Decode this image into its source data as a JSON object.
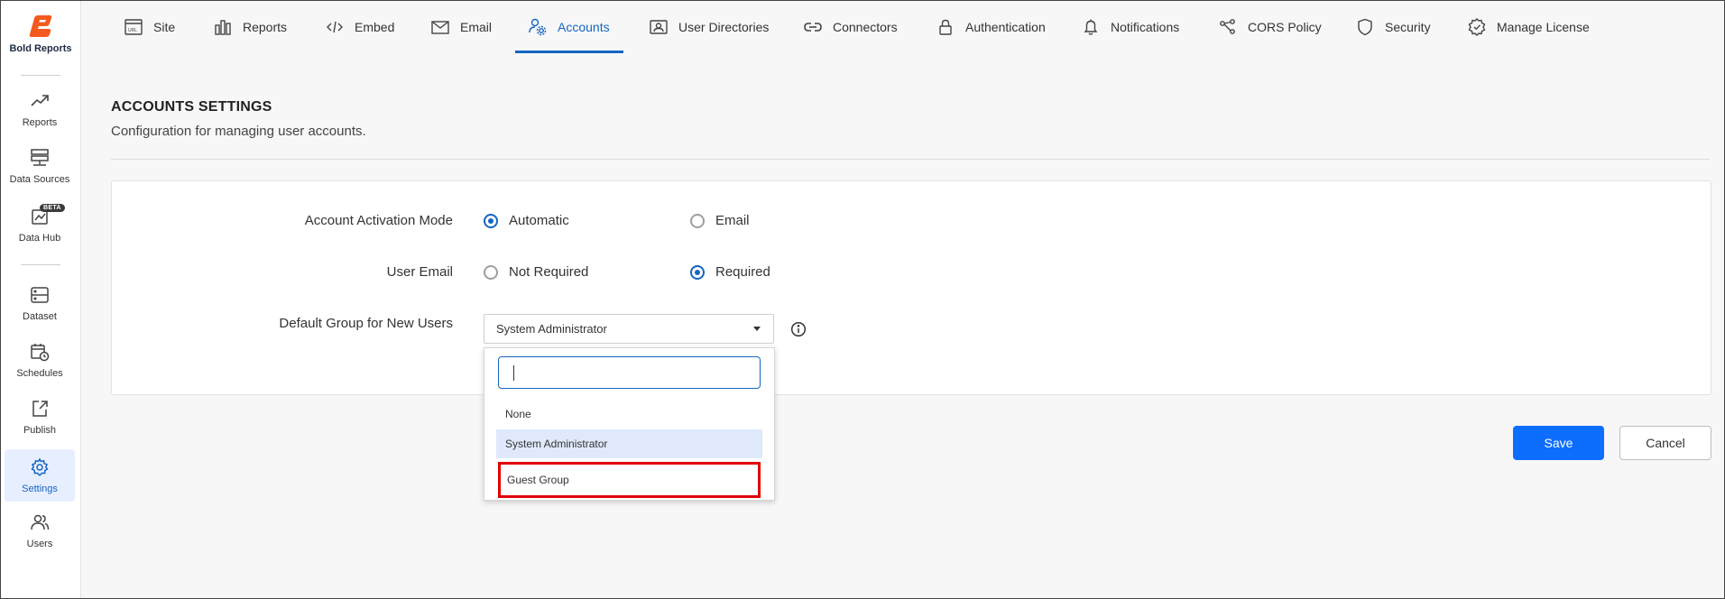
{
  "app": {
    "logo_text": "Bold Reports",
    "brand_color": "#f45a1f",
    "accent_color": "#1565c0"
  },
  "sidebar": {
    "items": [
      {
        "label": "Reports",
        "icon": "trending-up-icon"
      },
      {
        "label": "Data Sources",
        "icon": "server-icon"
      },
      {
        "label": "Data Hub",
        "icon": "data-hub-icon",
        "badge": "BETA"
      },
      {
        "label": "Dataset",
        "icon": "dataset-icon"
      },
      {
        "label": "Schedules",
        "icon": "calendar-clock-icon"
      },
      {
        "label": "Publish",
        "icon": "publish-icon"
      },
      {
        "label": "Settings",
        "icon": "gear-icon",
        "active": true
      },
      {
        "label": "Users",
        "icon": "users-icon"
      }
    ]
  },
  "tabs": [
    {
      "label": "Site",
      "icon": "url-icon"
    },
    {
      "label": "Reports",
      "icon": "bar-chart-icon"
    },
    {
      "label": "Embed",
      "icon": "code-icon"
    },
    {
      "label": "Email",
      "icon": "mail-icon"
    },
    {
      "label": "Accounts",
      "icon": "account-settings-icon",
      "active": true
    },
    {
      "label": "User Directories",
      "icon": "contact-card-icon"
    },
    {
      "label": "Connectors",
      "icon": "link-icon"
    },
    {
      "label": "Authentication",
      "icon": "lock-icon"
    },
    {
      "label": "Notifications",
      "icon": "bell-icon"
    },
    {
      "label": "CORS Policy",
      "icon": "share-nodes-icon"
    },
    {
      "label": "Security",
      "icon": "shield-icon"
    },
    {
      "label": "Manage License",
      "icon": "license-badge-icon"
    }
  ],
  "page": {
    "title": "ACCOUNTS SETTINGS",
    "subtitle": "Configuration for managing user accounts."
  },
  "settings": {
    "activation": {
      "label": "Account Activation Mode",
      "options": [
        {
          "label": "Automatic",
          "checked": true
        },
        {
          "label": "Email",
          "checked": false
        }
      ]
    },
    "user_email": {
      "label": "User Email",
      "options": [
        {
          "label": "Not Required",
          "checked": false
        },
        {
          "label": "Required",
          "checked": true
        }
      ]
    },
    "default_group": {
      "label": "Default Group for New Users",
      "selected": "System Administrator",
      "search_value": "",
      "options": [
        {
          "label": "None"
        },
        {
          "label": "System Administrator",
          "selected": true
        },
        {
          "label": "Guest Group",
          "highlighted": true
        }
      ]
    }
  },
  "actions": {
    "save_label": "Save",
    "cancel_label": "Cancel"
  }
}
